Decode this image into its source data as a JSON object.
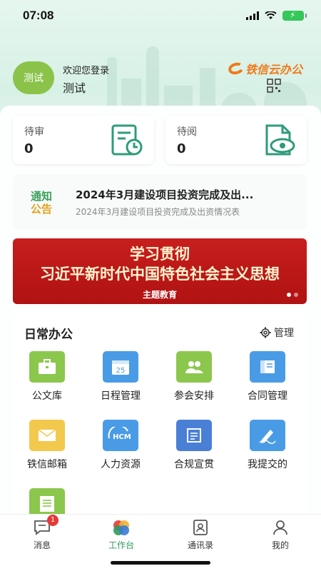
{
  "status": {
    "time": "07:08",
    "battery": "⚡"
  },
  "header": {
    "avatar_text": "测试",
    "welcome": "欢迎您登录",
    "username": "测试",
    "brand": "铁信云办公"
  },
  "tasks": [
    {
      "title": "待审",
      "count": "0"
    },
    {
      "title": "待阅",
      "count": "0"
    }
  ],
  "notice": {
    "badge_line1": "通知",
    "badge_line2": "公告",
    "title": "2024年3月建设项目投资完成及出...",
    "subtitle": "2024年3月建设项目投资完成及出资情况表"
  },
  "banner": {
    "line1": "学习贯彻",
    "line2": "习近平新时代中国特色社会主义思想",
    "line3": "主题教育"
  },
  "office": {
    "title": "日常办公",
    "manage_label": "管理",
    "apps": [
      {
        "label": "公文库",
        "icon": "briefcase-icon",
        "color": "#8cc74d"
      },
      {
        "label": "日程管理",
        "icon": "calendar-icon",
        "color": "#4a9be6"
      },
      {
        "label": "参会安排",
        "icon": "people-icon",
        "color": "#8cc74d"
      },
      {
        "label": "合同管理",
        "icon": "book-icon",
        "color": "#4a9be6"
      },
      {
        "label": "铁信邮箱",
        "icon": "mail-icon",
        "color": "#f2c94c"
      },
      {
        "label": "人力资源",
        "icon": "hcm-icon",
        "color": "#4a9be6"
      },
      {
        "label": "合规宣贯",
        "icon": "document-icon",
        "color": "#4a7fd6"
      },
      {
        "label": "我提交的",
        "icon": "pen-icon",
        "color": "#4a9be6"
      },
      {
        "label": "",
        "icon": "list-icon",
        "color": "#8cc74d"
      }
    ],
    "calendar_day": "25",
    "hcm_text": "HCM"
  },
  "tabbar": {
    "tabs": [
      {
        "label": "消息",
        "badge": "1"
      },
      {
        "label": "工作台"
      },
      {
        "label": "通讯录"
      },
      {
        "label": "我的"
      }
    ]
  },
  "colors": {
    "accent": "#2e9b5c",
    "brand": "#f07a1a",
    "banner": "#c81e1e"
  }
}
